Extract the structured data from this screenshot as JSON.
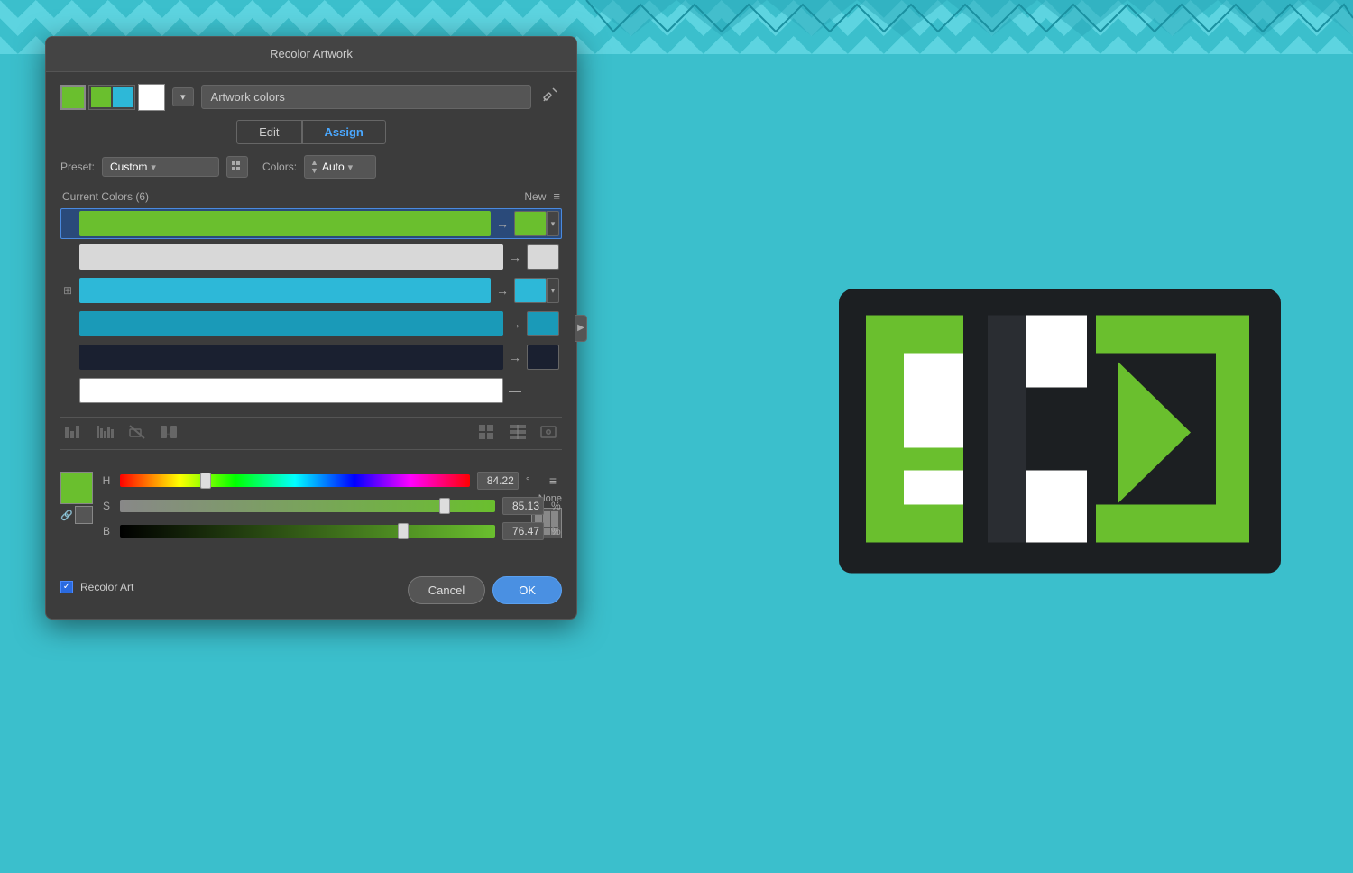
{
  "background": {
    "color": "#3bbfcc"
  },
  "dialog": {
    "title": "Recolor Artwork",
    "artwork_colors_label": "Artwork colors",
    "tabs": {
      "edit_label": "Edit",
      "assign_label": "Assign",
      "active": "assign"
    },
    "preset": {
      "label": "Preset:",
      "value": "Custom"
    },
    "colors": {
      "label": "Colors:",
      "value": "Auto"
    },
    "current_colors_header": "Current Colors (6)",
    "new_header": "New",
    "color_rows": [
      {
        "id": 1,
        "current_color": "#6abf2e",
        "new_color": "#6abf2e",
        "selected": true,
        "has_arrow": true
      },
      {
        "id": 2,
        "current_color": "#d0d0d0",
        "new_color": "#d0d0d0",
        "selected": false,
        "has_arrow": true
      },
      {
        "id": 3,
        "current_color": "#2db8d8",
        "new_color": "#2db8d8",
        "selected": false,
        "has_arrow": true,
        "has_handle": true
      },
      {
        "id": 4,
        "current_color": "#1a9ab8",
        "new_color": "#1a9ab8",
        "selected": false,
        "has_arrow": true
      },
      {
        "id": 5,
        "current_color": "#1a2a3a",
        "new_color": "#1a2a3a",
        "selected": false,
        "has_arrow": true
      },
      {
        "id": 6,
        "current_color": "#ffffff",
        "new_color": null,
        "selected": false,
        "has_arrow": false
      }
    ],
    "hsb": {
      "color_preview": "#6abf2e",
      "h_label": "H",
      "h_value": "84.22",
      "h_unit": "°",
      "h_thumb_pct": 23,
      "s_label": "S",
      "s_value": "85.13",
      "s_unit": "%",
      "s_thumb_pct": 85,
      "b_label": "B",
      "b_value": "76.47",
      "b_unit": "%",
      "b_thumb_pct": 76
    },
    "none_label": "None",
    "recolor_art_label": "Recolor Art",
    "recolor_art_checked": true,
    "cancel_label": "Cancel",
    "ok_label": "OK"
  }
}
